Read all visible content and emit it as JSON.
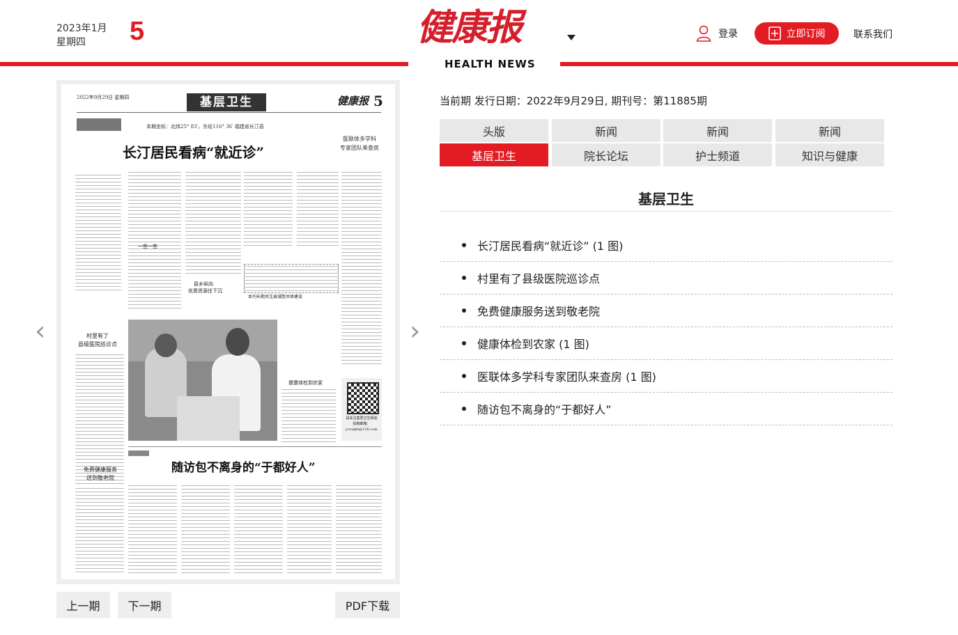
{
  "header": {
    "date_line1": "2023年1月",
    "date_line2": "星期四",
    "day": "5",
    "logo_cn": "健康报",
    "logo_en": "HEALTH NEWS",
    "login_label": "登录",
    "subscribe_label": "立即订阅",
    "contact_label": "联系我们"
  },
  "paper": {
    "header_date": "2022年9月29日 星期四",
    "section_banner": "基层卫生",
    "masthead": "健康报",
    "page_no": "5",
    "coords": "本期坐标：北纬25° 83′，东经116° 36′   福建省长汀县",
    "side_heading_1": "医联体多学科",
    "side_heading_2": "专家团队来查房",
    "headline_main": "长汀居民看病“就近诊”",
    "sub_1": "村里有了",
    "sub_2": "县级医院巡诊点",
    "sub_3": "免费健康服务",
    "sub_4": "送到敬老院",
    "caption": "健康体检到农家",
    "qr_text_1": "请关注基层卫生频道",
    "qr_text_2": "投稿邮箱：",
    "qr_text_3": "jcwsjkb@126.com",
    "headline_bottom": "随访包不离身的“于都好人”",
    "mid_label_1": "一些一些",
    "mid_label_2": "县乡纵向",
    "mid_label_3": "优质资源往下沉",
    "quote": "本刊长期关注县域医共体建设"
  },
  "pager": {
    "prev": "上一期",
    "next": "下一期",
    "pdf": "PDF下载"
  },
  "issue_info": "当前期 发行日期：2022年9月29日, 期刊号：第11885期",
  "tabs": [
    {
      "label": "头版",
      "active": false
    },
    {
      "label": "新闻",
      "active": false
    },
    {
      "label": "新闻",
      "active": false
    },
    {
      "label": "新闻",
      "active": false
    },
    {
      "label": "基层卫生",
      "active": true
    },
    {
      "label": "院长论坛",
      "active": false
    },
    {
      "label": "护士频道",
      "active": false
    },
    {
      "label": "知识与健康",
      "active": false
    }
  ],
  "section_title": "基层卫生",
  "articles": [
    "长汀居民看病“就近诊” (1 图)",
    "村里有了县级医院巡诊点",
    "免费健康服务送到敬老院",
    "健康体检到农家 (1 图)",
    "医联体多学科专家团队来查房 (1 图)",
    "随访包不离身的“于都好人”"
  ],
  "colors": {
    "accent": "#e31b23",
    "tab_bg": "#e8e8e8",
    "panel_bg": "#eeeeee"
  }
}
